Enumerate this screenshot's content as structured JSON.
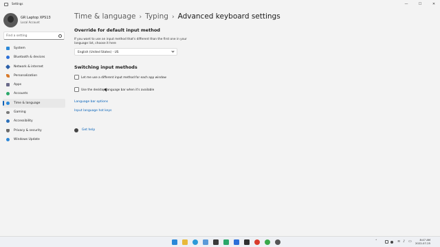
{
  "window": {
    "title": "Settings",
    "minimize_glyph": "—",
    "maximize_glyph": "☐",
    "close_glyph": "✕"
  },
  "profile": {
    "name": "GR Laptop XPS13",
    "account_type": "Local Account"
  },
  "search": {
    "placeholder": "Find a setting"
  },
  "sidebar": {
    "items": [
      {
        "label": "System",
        "icon": "system-icon",
        "color": "#2b88d8"
      },
      {
        "label": "Bluetooth & devices",
        "icon": "bluetooth-icon",
        "color": "#2b6fd8"
      },
      {
        "label": "Network & internet",
        "icon": "network-icon",
        "color": "#2b5fa8"
      },
      {
        "label": "Personalization",
        "icon": "personalization-icon",
        "color": "#d87a2b"
      },
      {
        "label": "Apps",
        "icon": "apps-icon",
        "color": "#6a6a8a"
      },
      {
        "label": "Accounts",
        "icon": "accounts-icon",
        "color": "#2ba86a"
      },
      {
        "label": "Time & language",
        "icon": "time-language-icon",
        "color": "#2b88d8",
        "selected": true
      },
      {
        "label": "Gaming",
        "icon": "gaming-icon",
        "color": "#7a7a7a"
      },
      {
        "label": "Accessibility",
        "icon": "accessibility-icon",
        "color": "#2b6fb8"
      },
      {
        "label": "Privacy & security",
        "icon": "shield-icon",
        "color": "#6a6a6a"
      },
      {
        "label": "Windows Update",
        "icon": "windows-update-icon",
        "color": "#2b88d8"
      }
    ]
  },
  "breadcrumb": {
    "part1": "Time & language",
    "part2": "Typing",
    "current": "Advanced keyboard settings",
    "separator": "›"
  },
  "override": {
    "title": "Override for default input method",
    "description": "If you want to use an input method that's different than the first one in your language list, choose it here",
    "dropdown_value": "English (United States) - US"
  },
  "switching": {
    "title": "Switching input methods",
    "checkbox1_label": "Let me use a different input method for each app window",
    "checkbox1_checked": false,
    "checkbox2_label": "Use the desktop language bar when it's available",
    "checkbox2_checked": false
  },
  "links": {
    "language_bar_options": "Language bar options",
    "input_language_hot_keys": "Input language hot keys"
  },
  "help": {
    "label": "Get help"
  },
  "taskbar": {
    "time": "8:47 AM",
    "date": "2022-07-25",
    "tray": {
      "chevron": "˄",
      "wifi": "≋",
      "volume": "♪",
      "battery": "▭"
    },
    "pinned": [
      {
        "name": "start-button",
        "color": "#2b88d8"
      },
      {
        "name": "file-explorer-icon",
        "color": "#e8b93a"
      },
      {
        "name": "edge-icon",
        "color": "#2b9ad8"
      },
      {
        "name": "notepad-icon",
        "color": "#5a9ad8"
      },
      {
        "name": "terminal-icon",
        "color": "#3a3a3a"
      },
      {
        "name": "spreadsheet-icon",
        "color": "#2ba86a"
      },
      {
        "name": "app-icon-blue",
        "color": "#2b6fd8"
      },
      {
        "name": "app-icon-dark",
        "color": "#303030"
      },
      {
        "name": "chrome-icon",
        "color": "#d83b2b"
      },
      {
        "name": "app-icon-green",
        "color": "#3aa84a"
      },
      {
        "name": "settings-gear-icon",
        "color": "#555555"
      }
    ]
  }
}
